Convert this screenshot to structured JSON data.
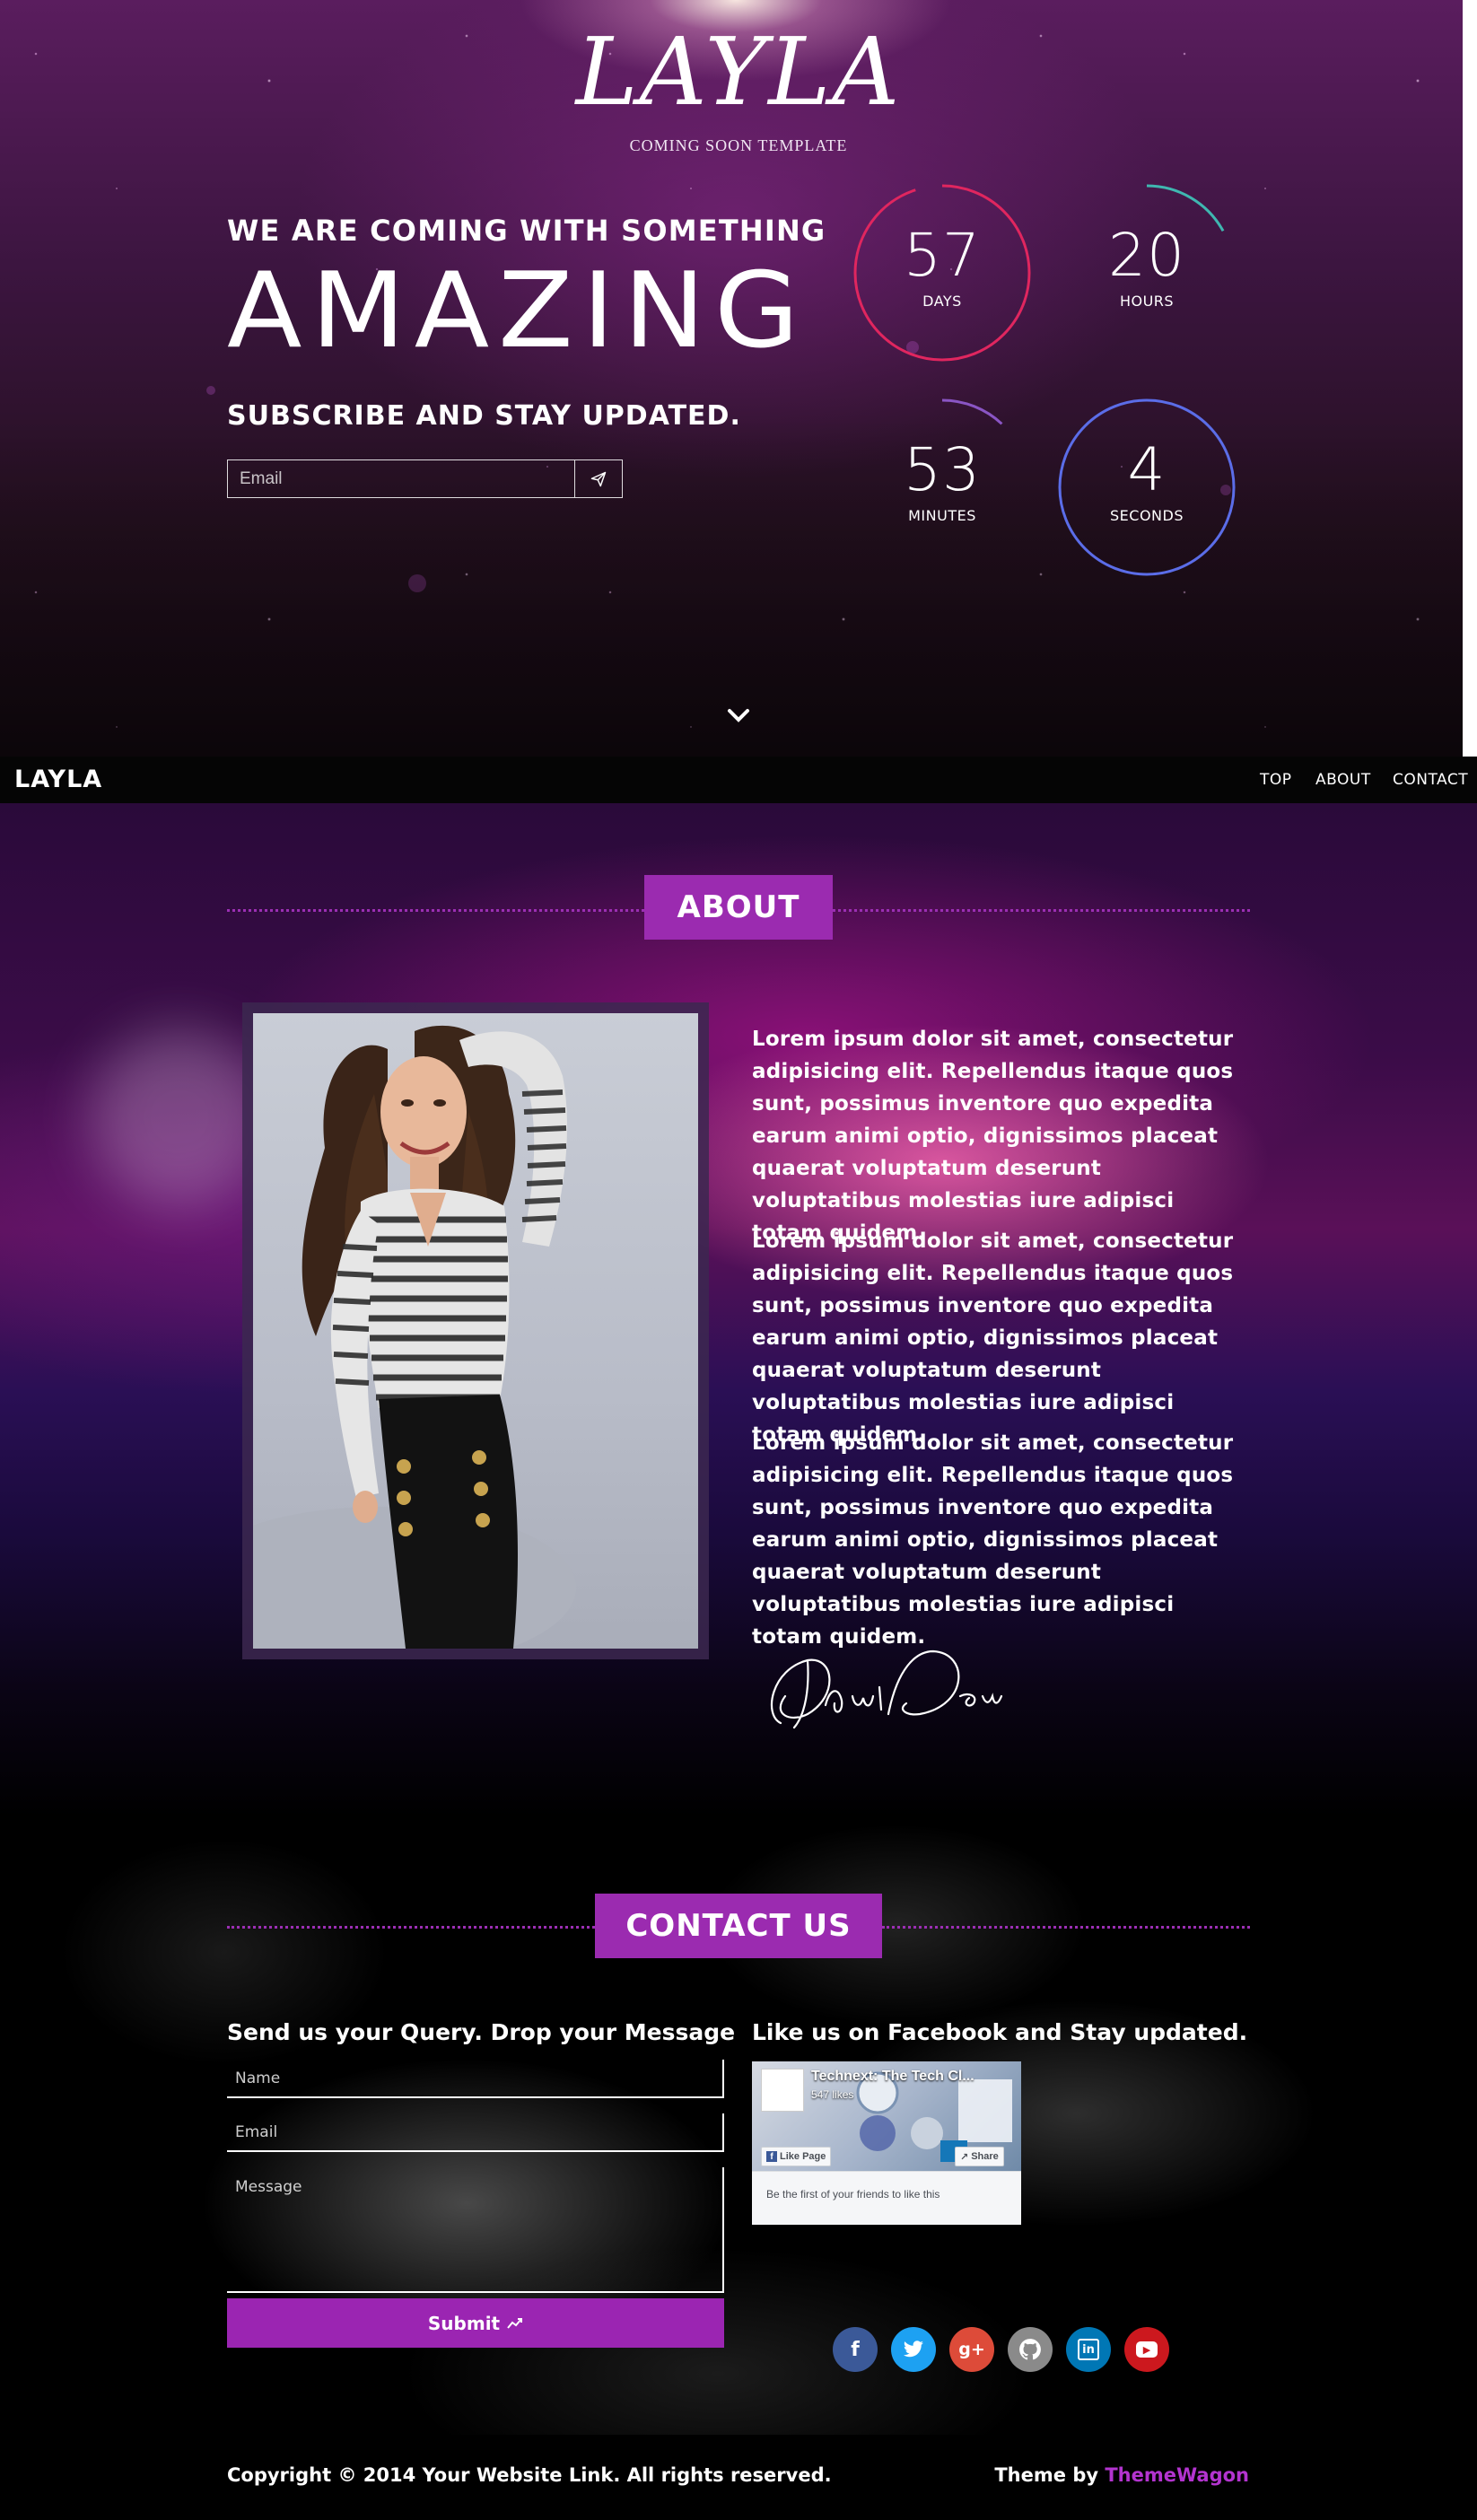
{
  "hero": {
    "logo": "LAYLA",
    "logo_sub": "COMING SOON TEMPLATE",
    "headline_small": "WE ARE COMING WITH SOMETHING",
    "headline_big": "AMAZING",
    "subscribe_title": "SUBSCRIBE AND STAY UPDATED.",
    "email_placeholder": "Email",
    "send_icon": "paper-plane-icon",
    "scroll_icon": "chevron-down-icon",
    "countdown": [
      {
        "value": "57",
        "label": "DAYS",
        "color": "#e0265f",
        "arc_fraction": 0.95
      },
      {
        "value": "20",
        "label": "HOURS",
        "color": "#3fb7b0",
        "arc_fraction": 0.17
      },
      {
        "value": "53",
        "label": "MINUTES",
        "color": "#8a55c4",
        "arc_fraction": 0.12
      },
      {
        "value": "4",
        "label": "SECONDS",
        "color": "#5b6de8",
        "arc_fraction": 1.0
      }
    ]
  },
  "nav": {
    "brand": "LAYLA",
    "items": [
      "TOP",
      "ABOUT",
      "CONTACT"
    ]
  },
  "about": {
    "title": "ABOUT",
    "paragraphs": [
      "Lorem ipsum dolor sit amet, consectetur adipisicing elit. Repellendus itaque quos sunt, possimus inventore quo expedita earum animi optio, dignissimos placeat quaerat voluptatum deserunt voluptatibus molestias iure adipisci totam quidem.",
      "Lorem ipsum dolor sit amet, consectetur adipisicing elit. Repellendus itaque quos sunt, possimus inventore quo expedita earum animi optio, dignissimos placeat quaerat voluptatum deserunt voluptatibus molestias iure adipisci totam quidem.",
      "Lorem ipsum dolor sit amet, consectetur adipisicing elit. Repellendus itaque quos sunt, possimus inventore quo expedita earum animi optio, dignissimos placeat quaerat voluptatum deserunt voluptatibus molestias iure adipisci totam quidem."
    ],
    "signature": "John Doe"
  },
  "contact": {
    "title": "CONTACT US",
    "form_heading": "Send us your Query. Drop your Message",
    "name_placeholder": "Name",
    "email_placeholder": "Email",
    "message_placeholder": "Message",
    "submit_label": "Submit",
    "facebook_heading": "Like us on Facebook and Stay updated.",
    "facebook": {
      "page_name": "Technext: The Tech Cl...",
      "likes": "547 likes",
      "like_button": "Like Page",
      "share_button": "Share",
      "friends_text": "Be the first of your friends to like this"
    },
    "social": [
      {
        "name": "facebook-icon",
        "glyph": "f",
        "color": "#3b5998"
      },
      {
        "name": "twitter-icon",
        "glyph": "t",
        "color": "#1da1f2"
      },
      {
        "name": "google-plus-icon",
        "glyph": "g+",
        "color": "#dd4b39"
      },
      {
        "name": "github-icon",
        "glyph": "gh",
        "color": "#8a8a8a"
      },
      {
        "name": "linkedin-icon",
        "glyph": "in",
        "color": "#0077b5"
      },
      {
        "name": "youtube-icon",
        "glyph": "▶",
        "color": "#cc181e"
      }
    ]
  },
  "footer": {
    "copyright": "Copyright © 2014 Your Website Link. All rights reserved.",
    "theme_prefix": "Theme by",
    "theme_link": "ThemeWagon"
  },
  "colors": {
    "accent": "#9b2bb0",
    "link": "#b334cf"
  }
}
